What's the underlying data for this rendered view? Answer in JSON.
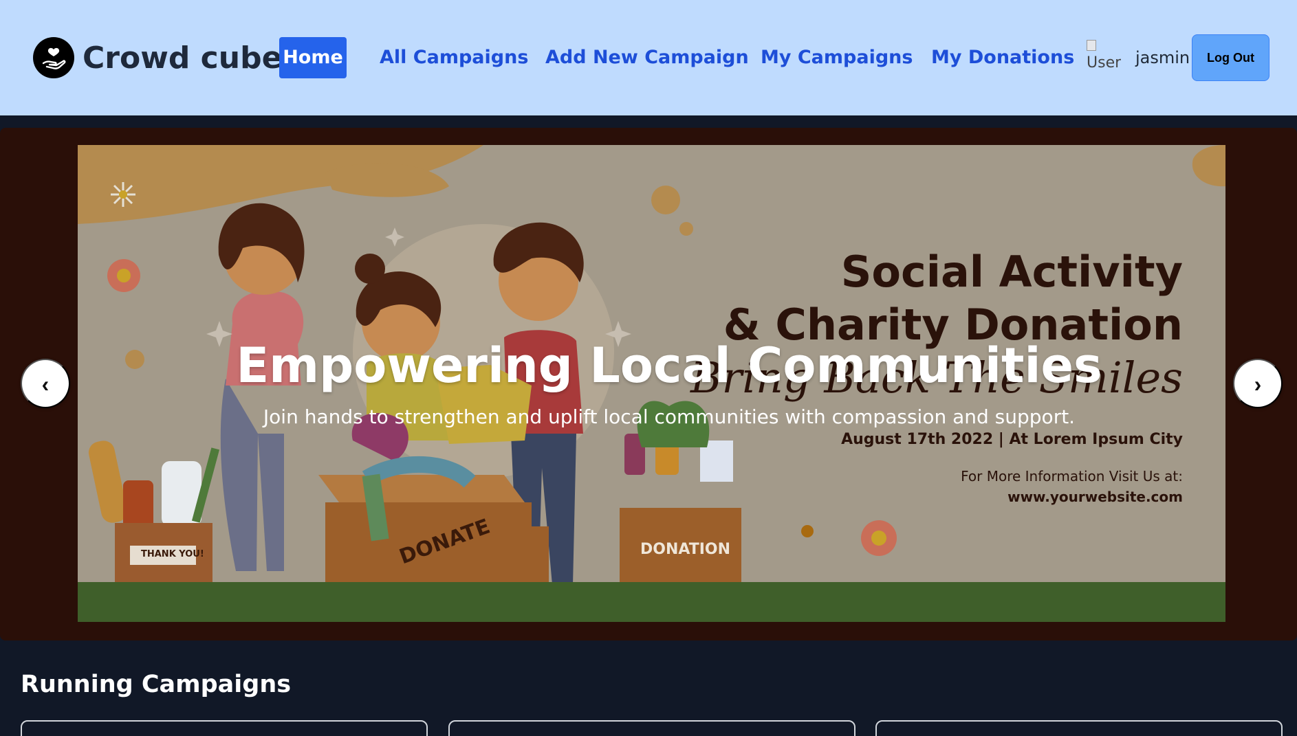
{
  "app": {
    "brand": "Crowd cube"
  },
  "nav": {
    "home": "Home",
    "all_campaigns": "All Campaigns",
    "add_campaign": "Add New Campaign",
    "my_campaigns": "My Campaigns",
    "my_donations": "My Donations"
  },
  "user": {
    "avatar_alt": "User",
    "name": "jasmin",
    "logout": "Log Out"
  },
  "hero": {
    "title": "Empowering Local Communities",
    "subtitle": "Join hands to strengthen and uplift local communities with compassion and support.",
    "prev": "‹",
    "next": "›",
    "banner": {
      "title1": "Social Activity",
      "title2": "& Charity Donation",
      "script": "Bring Back The Smiles",
      "date": "August 17th 2022  |  At Lorem Ipsum City",
      "info": "For More Information Visit Us at:",
      "website": "www.yourwebsite.com",
      "crate_left": "THANK YOU!",
      "crate_mid": "DONATE",
      "crate_right": "DONATION"
    }
  },
  "running": {
    "title": "Running Campaigns"
  },
  "colors": {
    "navbar": "#bfdbfe",
    "accent": "#2563eb",
    "nav_text": "#1d4ed8",
    "page_bg": "#111827",
    "logout": "#60a5fa"
  },
  "icons": {
    "logo": "heart-hand-icon"
  }
}
